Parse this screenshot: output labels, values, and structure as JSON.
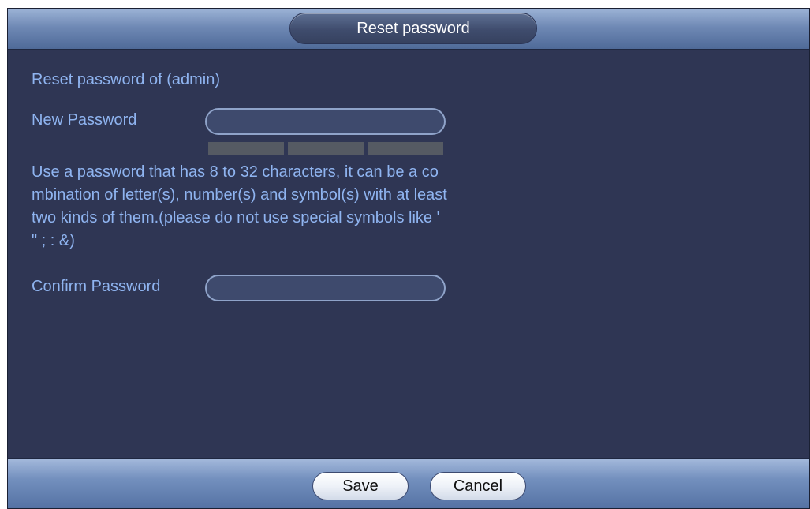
{
  "dialog": {
    "title": "Reset password"
  },
  "form": {
    "heading": "Reset password of (admin)",
    "new_password_label": "New Password",
    "new_password_value": "",
    "password_strength_segments": 3,
    "hint": "Use a password that has 8 to 32 characters, it can be a combination of letter(s), number(s) and symbol(s) with at least two kinds of them.(please do not use special symbols like ' \" ; : &)",
    "confirm_password_label": "Confirm Password",
    "confirm_password_value": ""
  },
  "footer": {
    "save_label": "Save",
    "cancel_label": "Cancel"
  },
  "colors": {
    "text_accent": "#8fb4f0",
    "background": "#2f3654",
    "strength_bar_empty": "#555a63"
  }
}
